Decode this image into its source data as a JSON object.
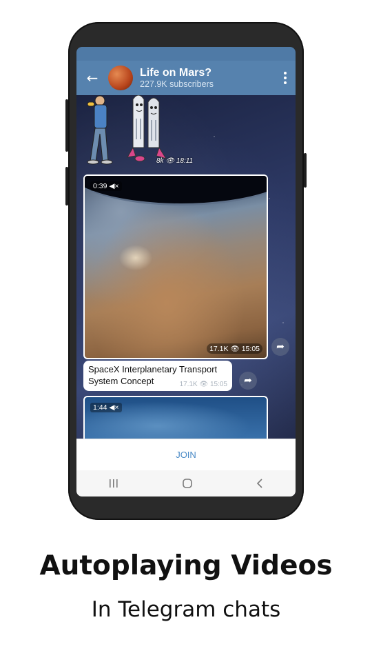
{
  "channel": {
    "title": "Life on Mars?",
    "subtitle": "227.9K subscribers"
  },
  "sticker": {
    "views": "8k",
    "time": "18:11"
  },
  "video1": {
    "duration": "0:39",
    "views": "17.1K",
    "time": "15:05"
  },
  "message": {
    "text": "SpaceX Interplanetary Transport System Concept",
    "views": "17.1K",
    "time": "15:05"
  },
  "video2": {
    "duration": "1:44"
  },
  "join_label": "JOIN",
  "caption": {
    "title": "Autoplaying Videos",
    "subtitle": "In Telegram chats"
  },
  "colors": {
    "header": "#5682ae",
    "accent": "#4a8ac6"
  },
  "icons": {
    "back": "arrow-left",
    "menu": "vertical-dots",
    "share": "share-arrow",
    "muted": "speaker-muted",
    "views": "eye"
  }
}
